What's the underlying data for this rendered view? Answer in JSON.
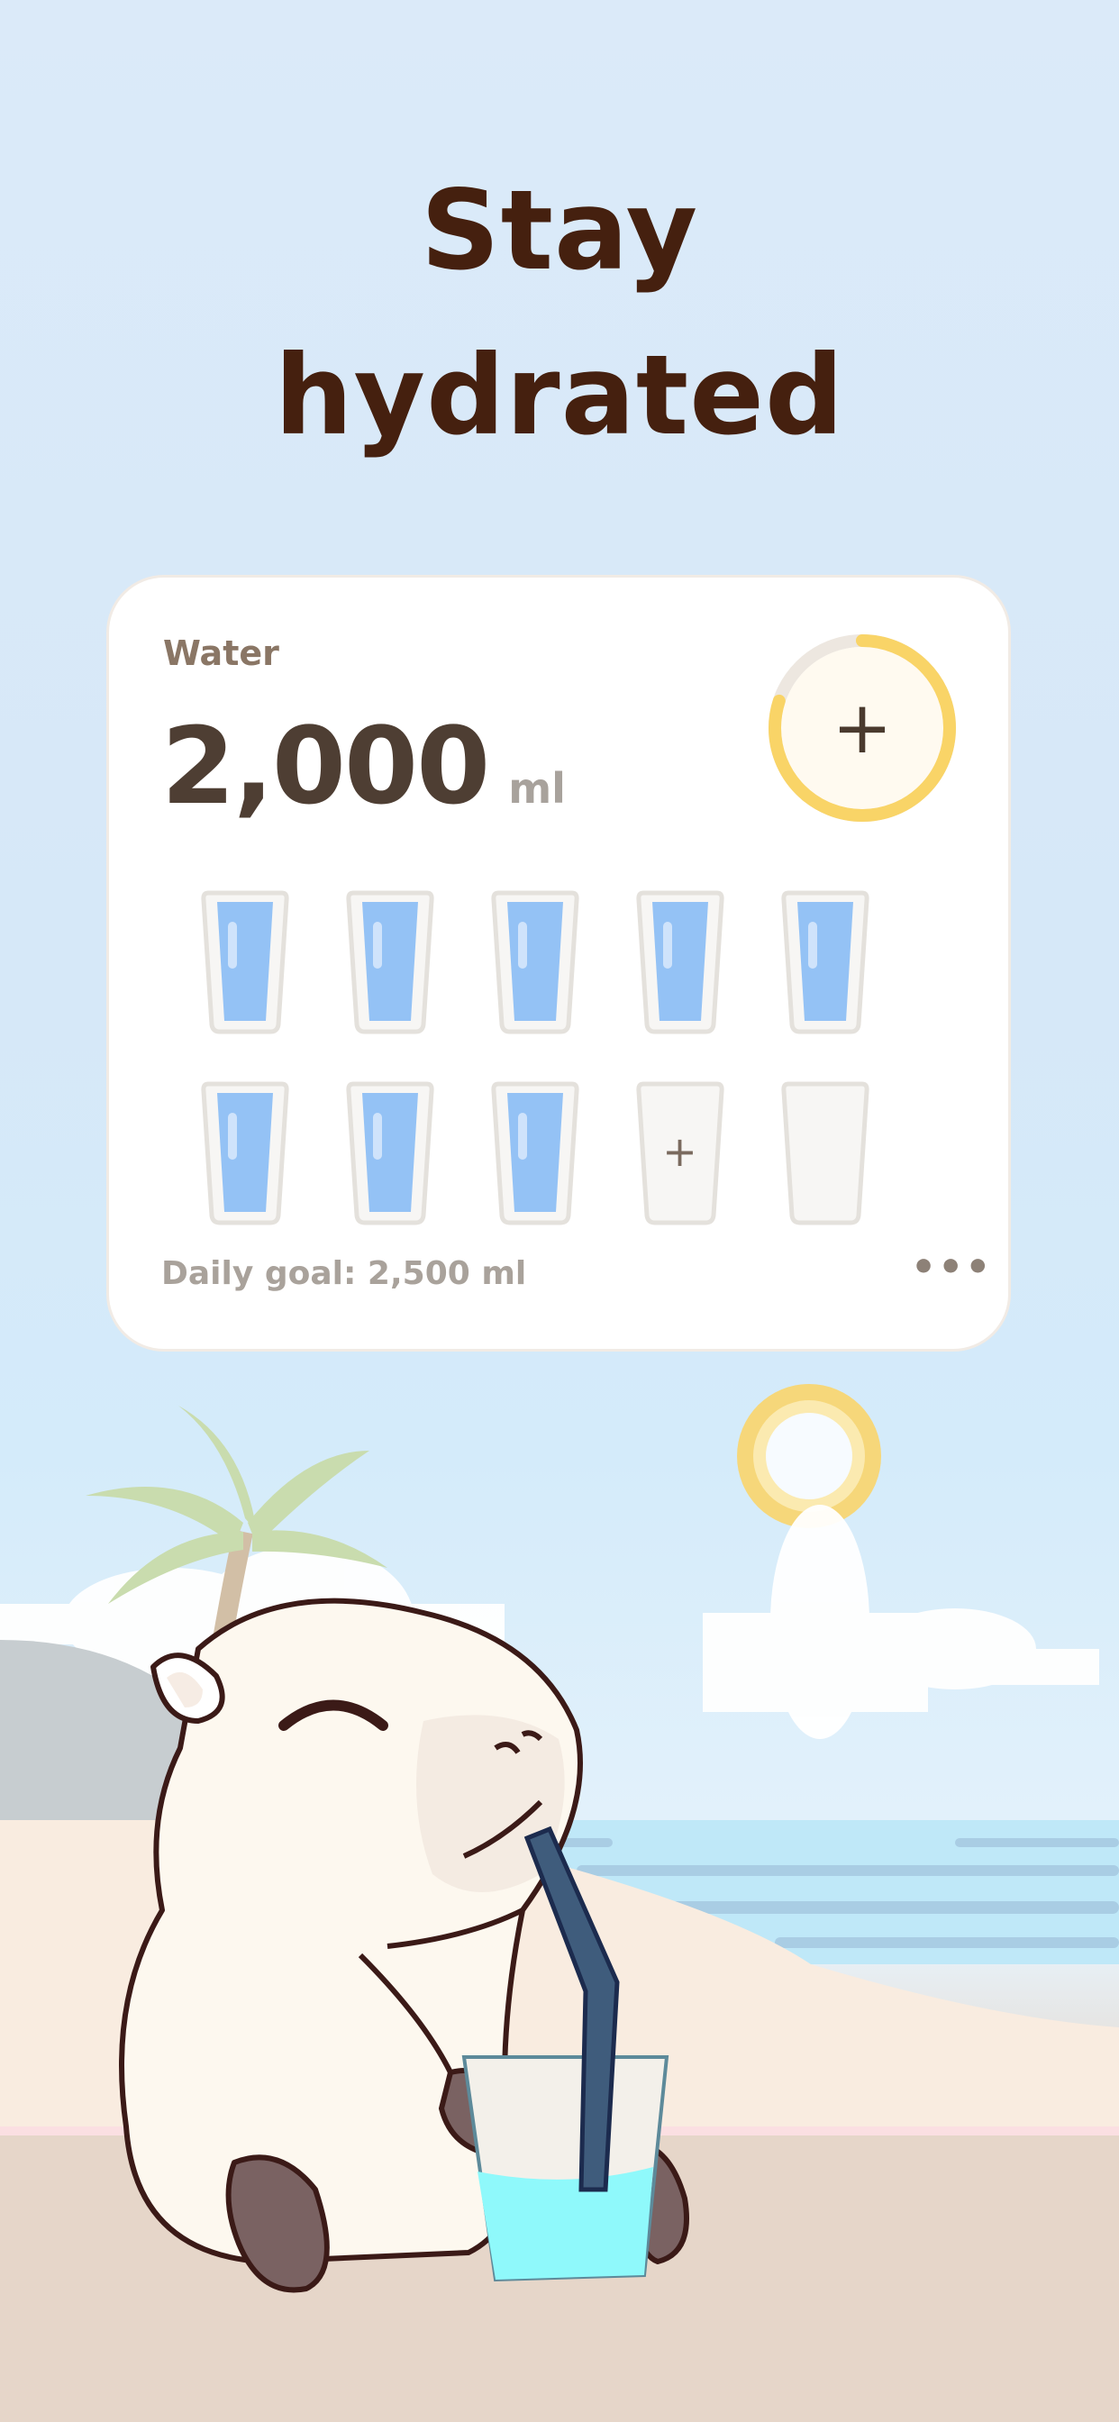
{
  "headline": {
    "line1": "Stay",
    "line2": "hydrated"
  },
  "card": {
    "title": "Water",
    "amount": "2,000",
    "unit": "ml",
    "add_icon": "plus-icon",
    "progress": 0.8,
    "goal_text": "Daily goal: 2,500 ml",
    "more_label": "•••",
    "cups": [
      {
        "state": "filled"
      },
      {
        "state": "filled"
      },
      {
        "state": "filled"
      },
      {
        "state": "filled"
      },
      {
        "state": "filled"
      },
      {
        "state": "filled"
      },
      {
        "state": "filled"
      },
      {
        "state": "filled"
      },
      {
        "state": "add"
      },
      {
        "state": "empty"
      }
    ]
  },
  "colors": {
    "headline": "#45200f",
    "water": "#94c2f5",
    "progress_ring": "#f9d467",
    "card_bg": "#ffffff"
  },
  "illustration": "capybara-drinking-water-at-beach"
}
